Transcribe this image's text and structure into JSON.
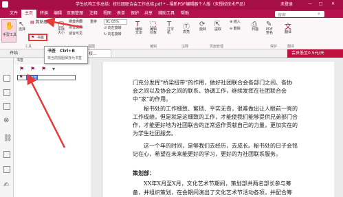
{
  "title": {
    "text": "学生机构工作总结：校社团联合会工作总结.pdf * - 福昕PDF编辑器个人版（未授权技术产品）",
    "user": "未登录"
  },
  "menu": {
    "items": [
      "文件",
      "主页",
      "转换",
      "编辑",
      "页面管理",
      "注释",
      "视图",
      "表单",
      "保护",
      "共享",
      "辅助工具",
      "帮助"
    ],
    "search_placeholder": "搜索"
  },
  "ribbon": {
    "hand_tool": "手型工具",
    "select": "选择",
    "clipboard": "剪贴板",
    "bookmark": "书签",
    "actual_size": "实际大小",
    "fit_page": "适合页面",
    "fit_width": "适合宽度",
    "fit_visible": "适合可见",
    "reflow": "重排",
    "zoom": "91.05%",
    "rotate_left": "向左旋转",
    "rotate_right": "向右旋转",
    "edit_text": "编辑文本",
    "edit_object": "编辑对象",
    "typewriter": "打字机",
    "highlight": "高亮",
    "rotate": "旋转",
    "extract": "提取",
    "insert": "插入",
    "delete": "删除",
    "scan": "扫描",
    "pdf_sign": "PDF签名",
    "translate": "翻译",
    "groups": [
      "工具",
      "视图",
      "编辑",
      "页面管理",
      "注释",
      "保护",
      "翻译"
    ]
  },
  "tabs": {
    "start": "开始",
    "doc": "学生机构工作总结：校...",
    "vip": "会员低至0.5元/天"
  },
  "tooltip": {
    "title": "书签",
    "shortcut": "Ctrl+B",
    "desc": "将当前视图保存为书签"
  },
  "bookmark_panel": {
    "header": "书签",
    "new_item": "新书签"
  },
  "document": {
    "paragraphs": [
      "门充分发挥“桥梁纽带”的作用，做好社团联合会各部门之间、各协",
      "会之间以及协会之间的联系、协调工作，继续发挥在社团联合会",
      "中“家”的作用。",
      "秘书处的工作细致、繁琐、平实无奇，很难做出让人眼前一亮的",
      "工作成绩，但是就是这细致的工作，才能使我们能够提供兄弟部门合",
      "作，才能更好地为社团联合的正常运作贡献自己的力量，更加实在的",
      "为学生社团服务。",
      "这一个年的时间，是够我们去经历，去成长。秘书处的日子会铭",
      "记在心，希望在未来能更好的学习，更好的为社团联系服务。",
      "策划部：",
      "XX年X月至X月，文化艺术节期间，策划部共两名部长参与筹",
      "备，并组织策划，在会期间演出了文化艺术节活动各项，并配合筹"
    ]
  }
}
